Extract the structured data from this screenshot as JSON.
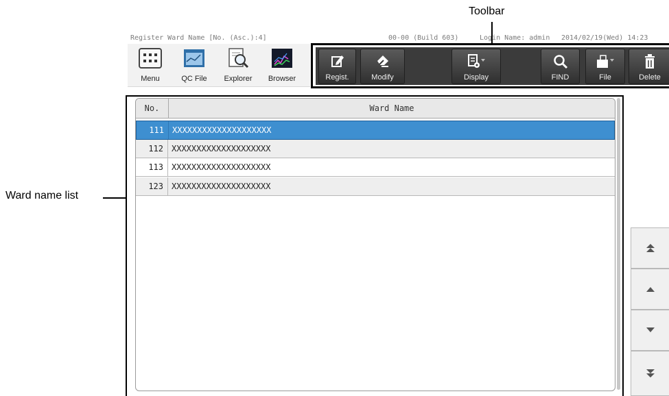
{
  "callouts": {
    "toolbar": "Toolbar",
    "ward_list": "Ward name list"
  },
  "status": {
    "screen_title": "Register Ward Name [No. (Asc.):4]",
    "build_info": "00-00 (Build 603)",
    "login": "Login Name: admin",
    "datetime": "2014/02/19(Wed) 14:23"
  },
  "apps": [
    {
      "label": "Menu",
      "icon": "menu-grid-icon"
    },
    {
      "label": "QC File",
      "icon": "qc-file-icon"
    },
    {
      "label": "Explorer",
      "icon": "explorer-magnifier-icon"
    },
    {
      "label": "Browser",
      "icon": "browser-chart-icon"
    }
  ],
  "toolbar": {
    "regist": "Regist.",
    "modify": "Modify",
    "display": "Display",
    "find": "FIND",
    "file": "File",
    "delete": "Delete"
  },
  "table": {
    "columns": [
      "No.",
      "Ward Name"
    ],
    "rows": [
      {
        "no": "111",
        "name": "XXXXXXXXXXXXXXXXXXXX",
        "selected": true
      },
      {
        "no": "112",
        "name": "XXXXXXXXXXXXXXXXXXXX",
        "selected": false
      },
      {
        "no": "113",
        "name": "XXXXXXXXXXXXXXXXXXXX",
        "selected": false
      },
      {
        "no": "123",
        "name": "XXXXXXXXXXXXXXXXXXXX",
        "selected": false
      }
    ]
  },
  "colors": {
    "selected_row": "#3e8fd0",
    "toolbar_bg": "#3b3b3b"
  }
}
